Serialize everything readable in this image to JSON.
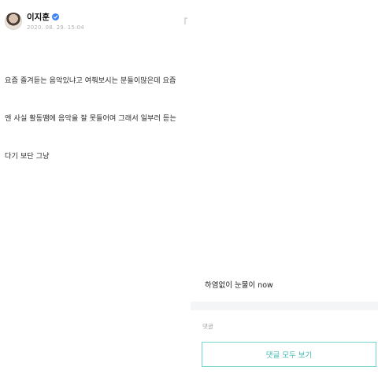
{
  "post": {
    "author_name": "이지훈",
    "date": "2020. 08. 29. 15:04",
    "body_lines": [
      "요즘 즐겨듣는 음악있냐고 여쭤보시는 분들이많은데 요즘",
      "엔 사실 활동땜에 음악을 잘 못들어여 그래서 일부러 듣는",
      "다기 보단 그냥"
    ]
  },
  "comment_panel": {
    "comment_text": "하염없이 눈물이 now",
    "comments_label": "댓글",
    "view_all_label": "댓글 모두 보기"
  },
  "colors": {
    "verified_badge": "#3b82f6",
    "view_all_border": "#74d6d1",
    "view_all_text": "#3cb9b3",
    "separator_band": "#f4f5f6"
  },
  "icons": {
    "verified": "verified-check-icon",
    "more": "more-options-icon"
  }
}
